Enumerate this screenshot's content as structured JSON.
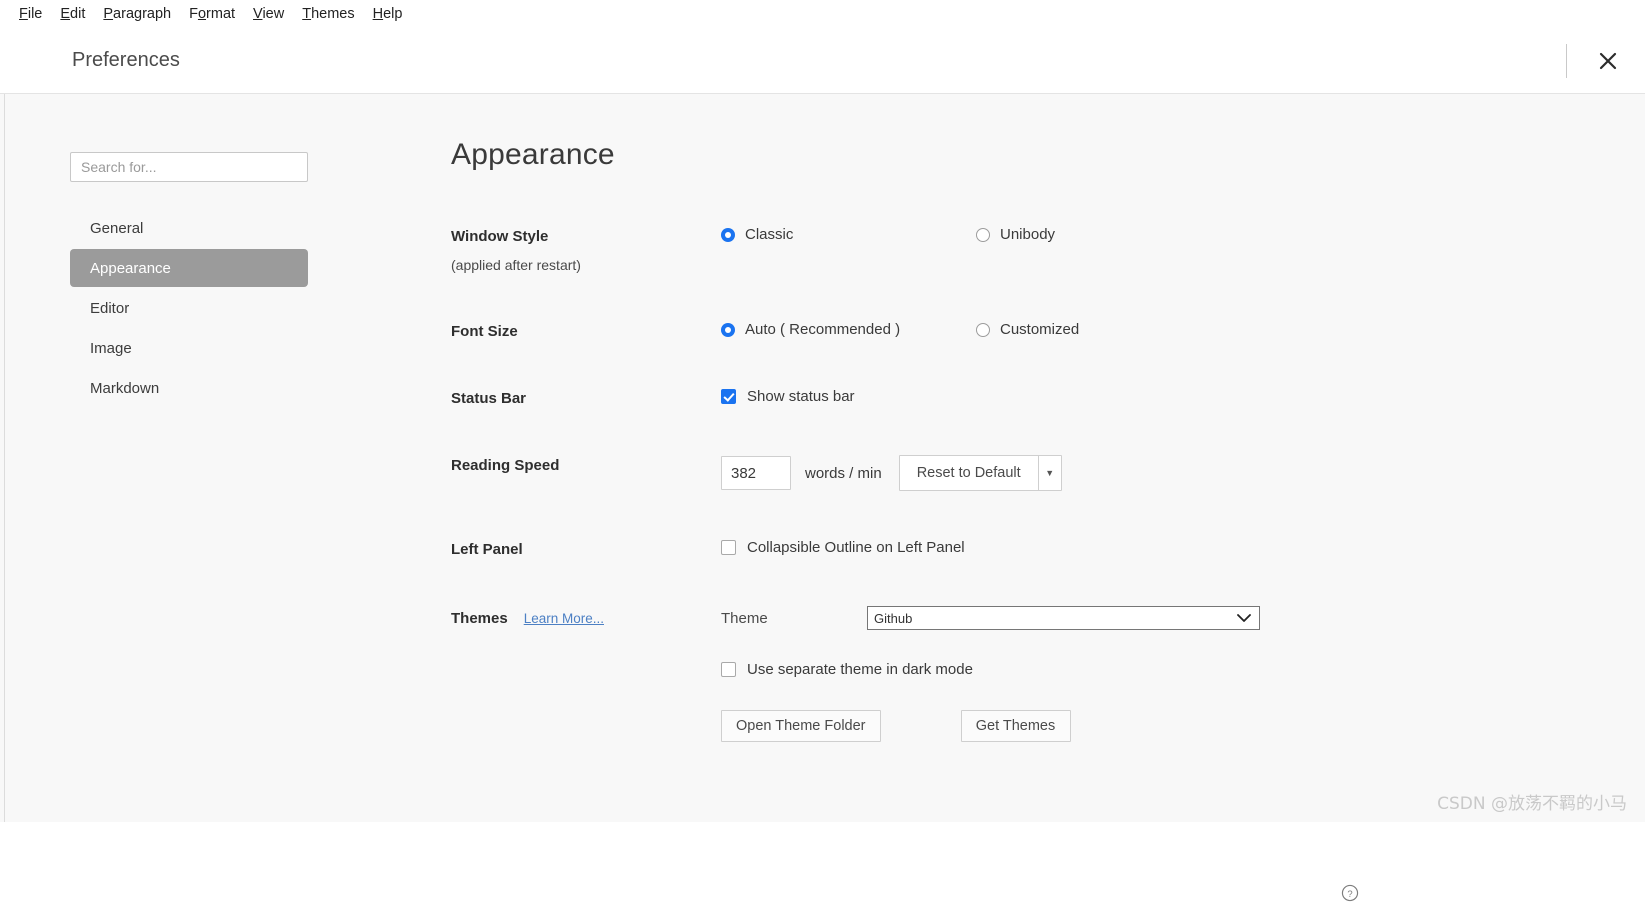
{
  "menubar": {
    "items": [
      {
        "pre": "",
        "acc": "F",
        "post": "ile"
      },
      {
        "pre": "",
        "acc": "E",
        "post": "dit"
      },
      {
        "pre": "",
        "acc": "P",
        "post": "aragraph"
      },
      {
        "pre": "F",
        "acc": "o",
        "post": "rmat"
      },
      {
        "pre": "",
        "acc": "V",
        "post": "iew"
      },
      {
        "pre": "",
        "acc": "T",
        "post": "hemes"
      },
      {
        "pre": "",
        "acc": "H",
        "post": "elp"
      }
    ]
  },
  "titlebar": {
    "title": "Preferences",
    "close_label": "close-icon"
  },
  "sidebar": {
    "search_placeholder": "Search for...",
    "search_value": "",
    "items": [
      {
        "label": "General",
        "selected": false
      },
      {
        "label": "Appearance",
        "selected": true
      },
      {
        "label": "Editor",
        "selected": false
      },
      {
        "label": "Image",
        "selected": false
      },
      {
        "label": "Markdown",
        "selected": false
      }
    ]
  },
  "content": {
    "page_title": "Appearance",
    "window_style": {
      "label": "Window Style",
      "sublabel": "(applied after restart)",
      "options": [
        {
          "label": "Classic",
          "selected": true
        },
        {
          "label": "Unibody",
          "selected": false
        }
      ]
    },
    "font_size": {
      "label": "Font Size",
      "options": [
        {
          "label": "Auto ( Recommended )",
          "selected": true
        },
        {
          "label": "Customized",
          "selected": false
        }
      ]
    },
    "status_bar": {
      "label": "Status Bar",
      "checkbox_label": "Show status bar",
      "checked": true
    },
    "reading_speed": {
      "label": "Reading Speed",
      "value": "382",
      "unit": "words / min",
      "reset_button": "Reset to Default",
      "dropdown_caret": "▼"
    },
    "left_panel": {
      "label": "Left Panel",
      "checkbox_label": "Collapsible Outline on Left Panel",
      "checked": false
    },
    "themes": {
      "label": "Themes",
      "learn_more": "Learn More...",
      "theme_label": "Theme",
      "theme_value": "Github",
      "theme_options": [
        "Github"
      ],
      "dark_mode_label": "Use separate theme in dark mode",
      "dark_mode_checked": false,
      "open_folder_button": "Open Theme Folder",
      "get_themes_button": "Get Themes",
      "help_icon": "help-circle-icon"
    }
  },
  "watermark": "CSDN @放荡不羁的小马",
  "colors": {
    "accent": "#1a73f0",
    "selected_nav": "#9b9b9b",
    "body_bg": "#f8f8f8",
    "link": "#4d80c4"
  }
}
